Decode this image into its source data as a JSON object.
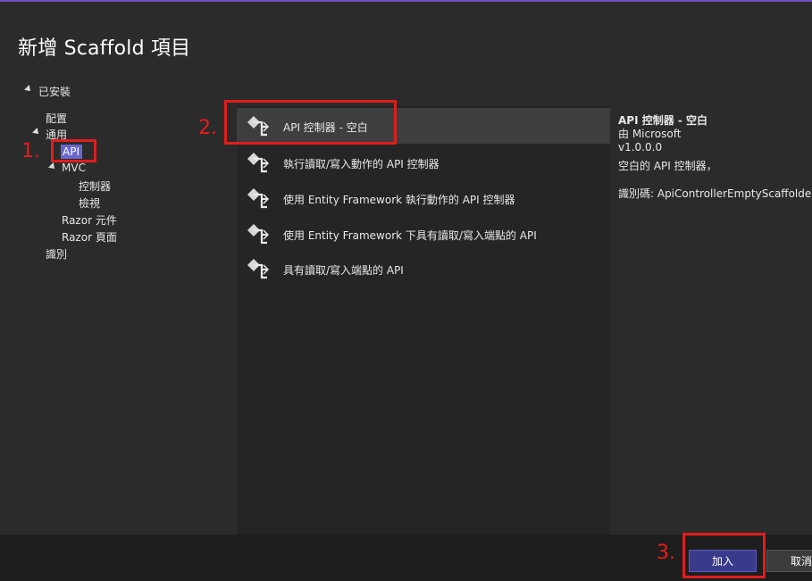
{
  "dialog": {
    "title": "新增 Scaffold 項目"
  },
  "tree": {
    "installed": "已安裝",
    "config": "配置",
    "common": "通用",
    "api": "API",
    "mvc": "MVC",
    "controller": "控制器",
    "view": "檢視",
    "razor_component": "Razor 元件",
    "razor_page": "Razor 頁面",
    "identity": "識別"
  },
  "list": {
    "items": [
      {
        "label": "API 控制器 - 空白",
        "icon": "api-controller-icon"
      },
      {
        "label": "執行讀取/寫入動作的 API 控制器",
        "icon": "api-controller-icon"
      },
      {
        "label": "使用 Entity Framework 執行動作的 API 控制器",
        "icon": "api-controller-icon"
      },
      {
        "label": "使用 Entity Framework 下具有讀取/寫入端點的 API",
        "icon": "api-controller-icon"
      },
      {
        "label": "具有讀取/寫入端點的 API",
        "icon": "api-controller-icon"
      }
    ],
    "selected_index": 0
  },
  "details": {
    "name": "API 控制器 - 空白",
    "author": "由 Microsoft",
    "version": "v1.0.0.0",
    "description": "空白的 API 控制器，",
    "id": "識別碼: ApiControllerEmptyScaffolder"
  },
  "buttons": {
    "add": "加入",
    "cancel": "取消"
  },
  "annotations": {
    "step1": "1.",
    "step2": "2.",
    "step3": "3."
  },
  "colors": {
    "accent": "#6666cc",
    "annotation": "#e01d1d",
    "add_button": "#3a3a8a"
  }
}
